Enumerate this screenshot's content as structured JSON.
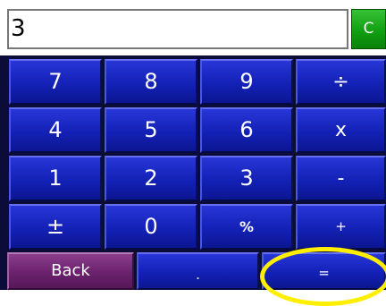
{
  "display": {
    "value": "3"
  },
  "clear_label": "C",
  "keys": {
    "seven": "7",
    "eight": "8",
    "nine": "9",
    "divide": "÷",
    "four": "4",
    "five": "5",
    "six": "6",
    "multiply": "x",
    "one": "1",
    "two": "2",
    "three": "3",
    "subtract": "-",
    "negate": "±",
    "zero": "0",
    "percent": "%",
    "add": "+",
    "back": "Back",
    "decimal": ".",
    "equals": "="
  },
  "colors": {
    "key_blue": "#1321b6",
    "clear_green": "#11a011",
    "back_purple": "#6b226e",
    "highlight_yellow": "#ffee00"
  }
}
